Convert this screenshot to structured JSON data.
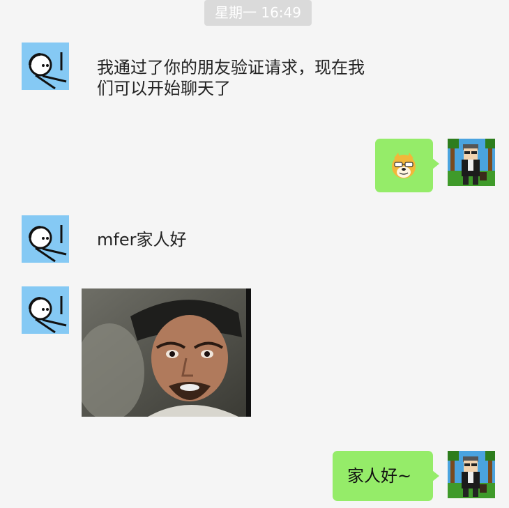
{
  "timestamp": "星期一 16:49",
  "messages": [
    {
      "text": "我通过了你的朋友验证请求，现在我们可以开始聊天了"
    },
    {
      "text": ""
    },
    {
      "text": "mfer家人好"
    },
    {
      "text": ""
    },
    {
      "text": "家人好~"
    }
  ],
  "colors": {
    "background": "#f5f5f5",
    "outgoing_bubble": "#95ec69",
    "contact_avatar_bg": "#85c9f4",
    "timestamp_bg": "#dadada"
  }
}
